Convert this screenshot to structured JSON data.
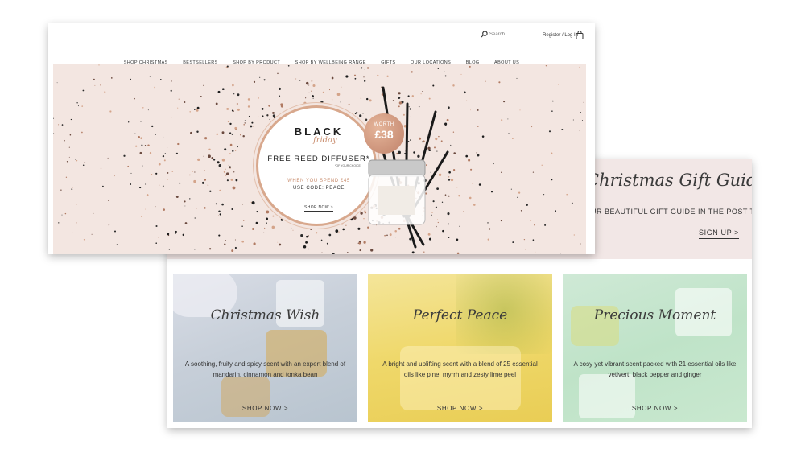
{
  "header": {
    "search_placeholder": "Search",
    "register_link": "Register / Log In",
    "cart_icon": "cart-icon",
    "search_icon": "search-icon"
  },
  "nav": {
    "items": [
      "SHOP CHRISTMAS",
      "BESTSELLERS",
      "SHOP BY PRODUCT",
      "SHOP BY WELLBEING RANGE",
      "GIFTS",
      "OUR LOCATIONS",
      "BLOG",
      "ABOUT US"
    ]
  },
  "hero": {
    "black": "BLACK",
    "friday": "friday",
    "reed_diffuser": "FREE REED DIFFUSER*",
    "choice_note": "*OF YOUR CHOICE",
    "spend": "WHEN YOU SPEND £45",
    "code": "USE CODE: PEACE",
    "shop_now": "SHOP NOW >",
    "worth_label": "WORTH",
    "worth_price": "£38",
    "accent_color": "#c98d6e",
    "background_color": "#f3e6e1"
  },
  "gift_guide": {
    "title": "Christmas Gift Guide",
    "subtitle": "UR BEAUTIFUL GIFT GUIDE IN THE POST TO YOU.",
    "signup": "SIGN UP >"
  },
  "products": [
    {
      "title": "Christmas Wish",
      "desc": "A soothing, fruity and spicy scent with an expert blend of mandarin, cinnamon and tonka bean",
      "shop": "SHOP NOW >"
    },
    {
      "title": "Perfect Peace",
      "desc": "A bright and uplifting scent with a blend of 25 essential oils like pine, myrrh and zesty lime peel",
      "shop": "SHOP NOW >"
    },
    {
      "title": "Precious Moment",
      "desc": "A cosy yet vibrant scent packed with 21 essential oils like vetivert, black pepper and ginger",
      "shop": "SHOP NOW >"
    }
  ]
}
